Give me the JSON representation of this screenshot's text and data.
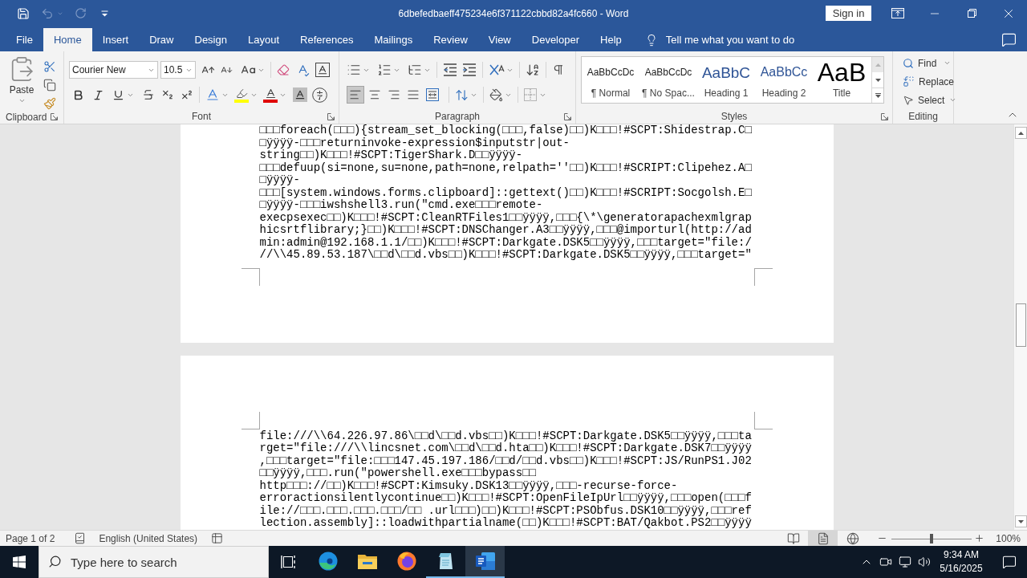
{
  "title_bar": {
    "quick_access": [
      {
        "kind": "save",
        "disabled": false
      },
      {
        "kind": "undo",
        "disabled": true
      },
      {
        "kind": "redo",
        "disabled": true
      },
      {
        "kind": "customize",
        "disabled": false
      }
    ],
    "title": "6dbefedbaeff475234e6f371122cbbd82a4fc660 - Word",
    "sign_in": "Sign in"
  },
  "tabs": [
    {
      "label": "File",
      "selected": false
    },
    {
      "label": "Home",
      "selected": true
    },
    {
      "label": "Insert",
      "selected": false
    },
    {
      "label": "Draw",
      "selected": false
    },
    {
      "label": "Design",
      "selected": false
    },
    {
      "label": "Layout",
      "selected": false
    },
    {
      "label": "References",
      "selected": false
    },
    {
      "label": "Mailings",
      "selected": false
    },
    {
      "label": "Review",
      "selected": false
    },
    {
      "label": "View",
      "selected": false
    },
    {
      "label": "Developer",
      "selected": false
    },
    {
      "label": "Help",
      "selected": false
    }
  ],
  "tell_me": {
    "placeholder": "Tell me what you want to do"
  },
  "ribbon": {
    "clipboard": {
      "paste": "Paste",
      "label": "Clipboard"
    },
    "font": {
      "name": "Courier New",
      "size": "10.5",
      "label": "Font"
    },
    "paragraph": {
      "alignment": [
        {
          "kind": "left",
          "selected": true
        },
        {
          "kind": "center",
          "selected": false
        },
        {
          "kind": "right",
          "selected": false
        },
        {
          "kind": "justify",
          "selected": false
        },
        {
          "kind": "distributed",
          "selected": false
        }
      ],
      "label": "Paragraph"
    },
    "styles": {
      "items": [
        {
          "preview": "AaBbCcDc",
          "name": "¶ Normal",
          "kind": "body"
        },
        {
          "preview": "AaBbCcDc",
          "name": "¶ No Spac...",
          "kind": "body"
        },
        {
          "preview": "AaBbC",
          "name": "Heading 1",
          "kind": "heading1"
        },
        {
          "preview": "AaBbCc",
          "name": "Heading 2",
          "kind": "heading2"
        },
        {
          "preview": "AaB",
          "name": "Title",
          "kind": "title"
        }
      ],
      "label": "Styles"
    },
    "editing": {
      "find": "Find",
      "replace": "Replace",
      "select": "Select",
      "label": "Editing"
    }
  },
  "document": {
    "pages": [
      {
        "lines": [
          "□□□foreach(□□□){stream_set_blocking(□□□,false)□□)K□□□!#SCPT:Shidestrap.C□",
          "□ÿÿÿÿ-□□□returninvoke-expression$inputstr|out-",
          "string□□)K□□□!#SCPT:TigerShark.D□□ÿÿÿÿ-",
          "□□□defuup(si=none,su=none,path=none,relpath=''□□)K□□□!#SCRIPT:Clipehez.A□",
          "□ÿÿÿÿ-",
          "□□□[system.windows.forms.clipboard]::gettext()□□)K□□□!#SCRIPT:Socgolsh.E□",
          "□ÿÿÿÿ-□□□iwshshell3.run(\"cmd.exe□□□remote-",
          "execpsexec□□)K□□□!#SCPT:CleanRTFiles1□□ÿÿÿÿ,□□□{\\*\\generatorapachexmlgrap",
          "hicsrtflibrary;}□□)K□□□!#SCPT:DNSChanger.A3□□ÿÿÿÿ,□□□@importurl(http://ad",
          "min:admin@192.168.1.1/□□)K□□□!#SCPT:Darkgate.DSK5□□ÿÿÿÿ,□□□target=\"file:/",
          "//\\\\45.89.53.187\\□□d\\□□d.vbs□□)K□□□!#SCPT:Darkgate.DSK5□□ÿÿÿÿ,□□□target=\""
        ]
      },
      {
        "lines": [
          "file:///\\\\64.226.97.86\\□□d\\□□d.vbs□□)K□□□!#SCPT:Darkgate.DSK5□□ÿÿÿÿ,□□□ta",
          "rget=\"file:///\\\\lincsnet.com\\□□d\\□□d.hta□□)K□□□!#SCPT:Darkgate.DSK7□□ÿÿÿÿ",
          ",□□□target=\"file:□□□147.45.197.186/□□d/□□d.vbs□□)K□□□!#SCPT:JS/RunPS1.J02",
          "□□ÿÿÿÿ,□□□.run(\"powershell.exe□□□bypass□□",
          "http□□□://□□)K□□□!#SCPT:Kimsuky.DSK13□□ÿÿÿÿ,□□□-recurse-force-",
          "erroractionsilentlycontinue□□)K□□□!#SCPT:OpenFileIpUrl□□ÿÿÿÿ,□□□open(□□□f",
          "ile://□□□.□□□.□□□.□□□/□□ .url□□□)□□)K□□□!#SCPT:PSObfus.DSK10□□ÿÿÿÿ,□□□ref",
          "lection.assembly]::loadwithpartialname(□□)K□□□!#SCPT:BAT/Qakbot.PS2□□ÿÿÿÿ"
        ]
      }
    ]
  },
  "status_bar": {
    "page": "Page 1 of 2",
    "language": "English (United States)",
    "views": [
      {
        "kind": "read",
        "selected": false
      },
      {
        "kind": "print",
        "selected": true
      },
      {
        "kind": "web",
        "selected": false
      }
    ],
    "zoom": {
      "level": 0.5,
      "reading": "100%"
    }
  },
  "taskbar": {
    "search": {
      "placeholder": "Type here to search"
    },
    "apps": [
      {
        "kind": "browser",
        "open": false,
        "selected": false
      },
      {
        "kind": "folder",
        "open": false,
        "selected": false
      },
      {
        "kind": "foxbrowser",
        "open": false,
        "selected": false
      },
      {
        "kind": "notepad",
        "open": true,
        "selected": false
      },
      {
        "kind": "document",
        "open": true,
        "selected": true
      }
    ],
    "time": "9:34 AM",
    "date": "5/16/2025"
  }
}
